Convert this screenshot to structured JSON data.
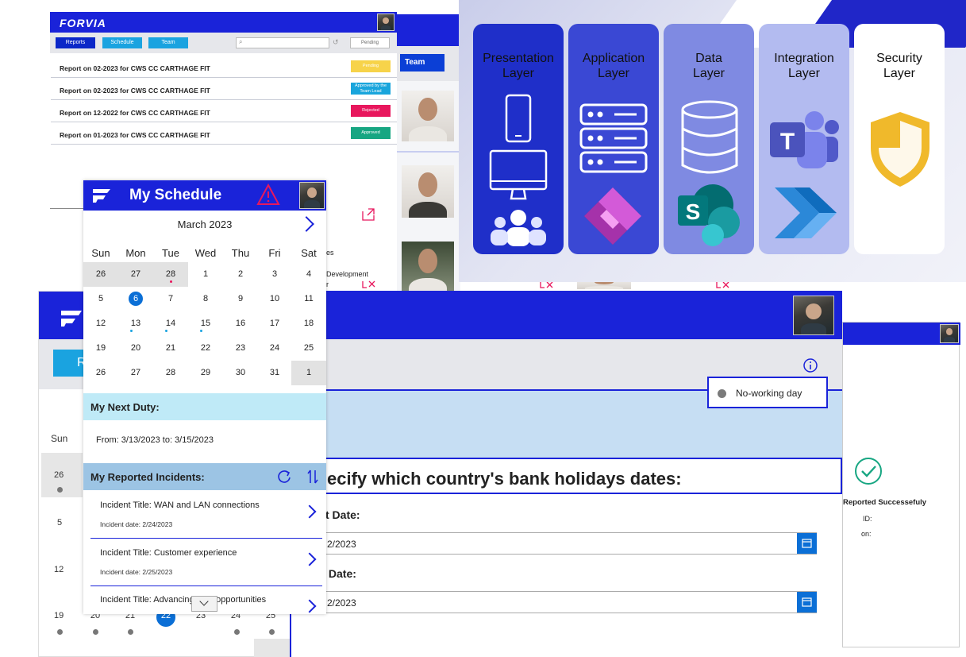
{
  "reports_panel": {
    "brand": "FORVIA",
    "tabs": [
      "Reports",
      "Schedule",
      "Team"
    ],
    "filter_value": "Pending",
    "team_tab": "Team",
    "rows": [
      {
        "title": "Report on 02-2023 for CWS CC CARTHAGE FIT",
        "status": "Pending",
        "color": "#f7d34a"
      },
      {
        "title": "Report on 02-2023 for CWS CC CARTHAGE FIT",
        "status": "Approved by the Team Lead",
        "color": "#19a5dc"
      },
      {
        "title": "Report on 12-2022 for CWS CC CARTHAGE FIT",
        "status": "Rejected",
        "color": "#e8175d"
      },
      {
        "title": "Report on 01-2023 for CWS CC CARTHAGE FIT",
        "status": "Approved",
        "color": "#17a682"
      }
    ],
    "team_fragments": [
      "es",
      "Development",
      "r"
    ]
  },
  "architecture": {
    "layers": [
      {
        "name": "Presentation\nLayer",
        "color": "#1f2fc9"
      },
      {
        "name": "Application\nLayer",
        "color": "#3a48d4"
      },
      {
        "name": "Data\nLayer",
        "color": "#7f8ae2"
      },
      {
        "name": "Integration\nLayer",
        "color": "#b3bbf0"
      },
      {
        "name": "Security\nLayer",
        "color": "#ffffff"
      }
    ]
  },
  "schedule": {
    "title": "My Schedule",
    "month": "March 2023",
    "weekdays": [
      "Sun",
      "Mon",
      "Tue",
      "Wed",
      "Thu",
      "Fri",
      "Sat"
    ],
    "weeks": [
      [
        "26",
        "27",
        "28",
        "1",
        "2",
        "3",
        "4"
      ],
      [
        "5",
        "6",
        "7",
        "8",
        "9",
        "10",
        "11"
      ],
      [
        "12",
        "13",
        "14",
        "15",
        "16",
        "17",
        "18"
      ],
      [
        "19",
        "20",
        "21",
        "22",
        "23",
        "24",
        "25"
      ],
      [
        "26",
        "27",
        "28",
        "29",
        "30",
        "31",
        "1"
      ]
    ],
    "next_duty_label": "My Next Duty:",
    "next_duty_value": "From: 3/13/2023 to: 3/15/2023",
    "incidents_label": "My Reported Incidents:",
    "incidents": [
      {
        "title": "Incident Title: WAN and LAN connections",
        "date": "Incident date: 2/24/2023"
      },
      {
        "title": "Incident Title: Customer experience",
        "date": "Incident date: 2/25/2023"
      },
      {
        "title": "Incident Title: Advancing data opportunities",
        "date": ""
      }
    ]
  },
  "left_calendar": {
    "button_fragment": "R",
    "sun_label": "Sun",
    "rows": [
      "26",
      "5",
      "12",
      "19"
    ],
    "bottom_row": [
      "20",
      "21",
      "22",
      "23",
      "24",
      "25"
    ]
  },
  "holiday_form": {
    "legend": "No-working day",
    "heading": "ecify which country's bank holidays dates:",
    "start_label": "t Date:",
    "start_value": "2/2023",
    "end_label": " Date:",
    "end_value": "2/2023"
  },
  "success_panel": {
    "message": "Reported Successefuly",
    "id_label": "ID:",
    "on_label": "on:"
  }
}
